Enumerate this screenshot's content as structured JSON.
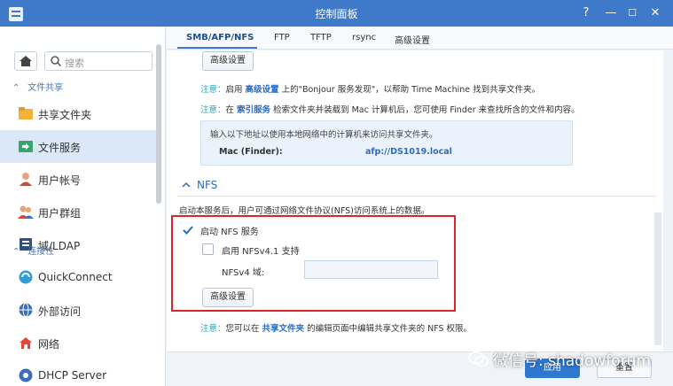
{
  "window": {
    "title": "控制面板",
    "help": "?",
    "minimize": "—",
    "maximize": "☐",
    "close": "✕"
  },
  "sidebar": {
    "search_placeholder": "搜索",
    "group_file_sharing": "文件共享",
    "group_connectivity": "连接性",
    "items": [
      {
        "label": "共享文件夹",
        "icon": "shared-folder-icon"
      },
      {
        "label": "文件服务",
        "icon": "file-services-icon",
        "active": true
      },
      {
        "label": "用户帐号",
        "icon": "user-icon"
      },
      {
        "label": "用户群组",
        "icon": "group-icon"
      },
      {
        "label": "域/LDAP",
        "icon": "domain-icon"
      },
      {
        "label": "QuickConnect",
        "icon": "quickconnect-icon"
      },
      {
        "label": "外部访问",
        "icon": "external-access-icon"
      },
      {
        "label": "网络",
        "icon": "network-icon"
      },
      {
        "label": "DHCP Server",
        "icon": "dhcp-icon"
      }
    ]
  },
  "tabs": [
    "SMB/AFP/NFS",
    "FTP",
    "TFTP",
    "rsync",
    "高级设置"
  ],
  "afp": {
    "advanced_button": "高级设置",
    "note1_prefix": "注意：",
    "note1_a": "启用 ",
    "note1_link": "高级设置",
    "note1_b": " 上的\"Bonjour 服务发现\"，以帮助 Time Machine 找到共享文件夹。",
    "note2_prefix": "注意：",
    "note2_a": "在 ",
    "note2_link": "索引服务",
    "note2_b": " 检索文件夹并装载到 Mac 计算机后，您可使用 Finder 来查找所含的文件和内容。",
    "info_line": "输入以下地址以使用本地网络中的计算机来访问共享文件夹。",
    "mac_label": "Mac (Finder):",
    "mac_value": "afp://DS1019.local"
  },
  "nfs": {
    "section_title": "NFS",
    "description": "启动本服务后，用户可通过网络文件协议(NFS)访问系统上的数据。",
    "enable_label": "启动 NFS 服务",
    "enable_checked": true,
    "nfs41_label": "启用 NFSv4.1 支持",
    "nfs41_checked": false,
    "domain_label": "NFSv4 域:",
    "domain_value": "",
    "advanced_button": "高级设置",
    "note_prefix": "注意：",
    "note_a": "您可以在 ",
    "note_link": "共享文件夹",
    "note_b": " 的编辑页面中编辑共享文件夹的 NFS 权限。"
  },
  "footer": {
    "apply": "应用",
    "reset": "重置"
  },
  "watermark": "微信号: shadowforum",
  "colors": {
    "titlebar": "#3f79c9",
    "accent": "#2b6cc4",
    "note_keyword": "#2aa2b5",
    "highlight": "#d8262a"
  }
}
